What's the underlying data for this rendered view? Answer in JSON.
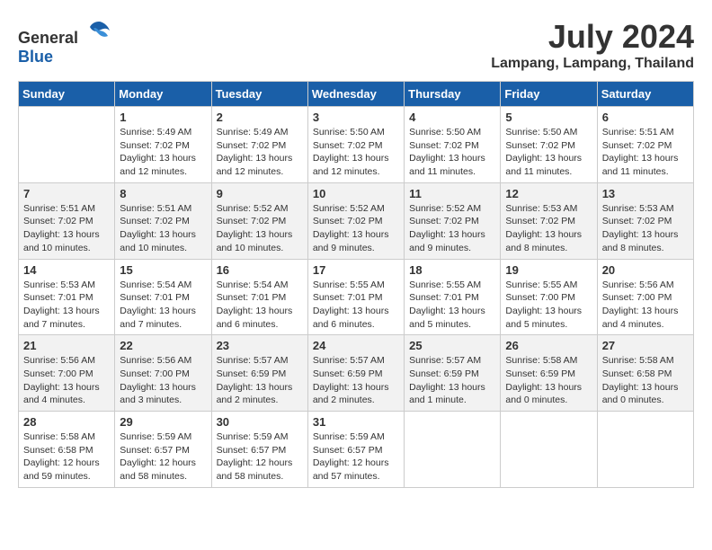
{
  "header": {
    "logo_general": "General",
    "logo_blue": "Blue",
    "month_title": "July 2024",
    "location": "Lampang, Lampang, Thailand"
  },
  "days_of_week": [
    "Sunday",
    "Monday",
    "Tuesday",
    "Wednesday",
    "Thursday",
    "Friday",
    "Saturday"
  ],
  "weeks": [
    [
      {
        "day": "",
        "sunrise": "",
        "sunset": "",
        "daylight": ""
      },
      {
        "day": "1",
        "sunrise": "Sunrise: 5:49 AM",
        "sunset": "Sunset: 7:02 PM",
        "daylight": "Daylight: 13 hours and 12 minutes."
      },
      {
        "day": "2",
        "sunrise": "Sunrise: 5:49 AM",
        "sunset": "Sunset: 7:02 PM",
        "daylight": "Daylight: 13 hours and 12 minutes."
      },
      {
        "day": "3",
        "sunrise": "Sunrise: 5:50 AM",
        "sunset": "Sunset: 7:02 PM",
        "daylight": "Daylight: 13 hours and 12 minutes."
      },
      {
        "day": "4",
        "sunrise": "Sunrise: 5:50 AM",
        "sunset": "Sunset: 7:02 PM",
        "daylight": "Daylight: 13 hours and 11 minutes."
      },
      {
        "day": "5",
        "sunrise": "Sunrise: 5:50 AM",
        "sunset": "Sunset: 7:02 PM",
        "daylight": "Daylight: 13 hours and 11 minutes."
      },
      {
        "day": "6",
        "sunrise": "Sunrise: 5:51 AM",
        "sunset": "Sunset: 7:02 PM",
        "daylight": "Daylight: 13 hours and 11 minutes."
      }
    ],
    [
      {
        "day": "7",
        "sunrise": "Sunrise: 5:51 AM",
        "sunset": "Sunset: 7:02 PM",
        "daylight": "Daylight: 13 hours and 10 minutes."
      },
      {
        "day": "8",
        "sunrise": "Sunrise: 5:51 AM",
        "sunset": "Sunset: 7:02 PM",
        "daylight": "Daylight: 13 hours and 10 minutes."
      },
      {
        "day": "9",
        "sunrise": "Sunrise: 5:52 AM",
        "sunset": "Sunset: 7:02 PM",
        "daylight": "Daylight: 13 hours and 10 minutes."
      },
      {
        "day": "10",
        "sunrise": "Sunrise: 5:52 AM",
        "sunset": "Sunset: 7:02 PM",
        "daylight": "Daylight: 13 hours and 9 minutes."
      },
      {
        "day": "11",
        "sunrise": "Sunrise: 5:52 AM",
        "sunset": "Sunset: 7:02 PM",
        "daylight": "Daylight: 13 hours and 9 minutes."
      },
      {
        "day": "12",
        "sunrise": "Sunrise: 5:53 AM",
        "sunset": "Sunset: 7:02 PM",
        "daylight": "Daylight: 13 hours and 8 minutes."
      },
      {
        "day": "13",
        "sunrise": "Sunrise: 5:53 AM",
        "sunset": "Sunset: 7:02 PM",
        "daylight": "Daylight: 13 hours and 8 minutes."
      }
    ],
    [
      {
        "day": "14",
        "sunrise": "Sunrise: 5:53 AM",
        "sunset": "Sunset: 7:01 PM",
        "daylight": "Daylight: 13 hours and 7 minutes."
      },
      {
        "day": "15",
        "sunrise": "Sunrise: 5:54 AM",
        "sunset": "Sunset: 7:01 PM",
        "daylight": "Daylight: 13 hours and 7 minutes."
      },
      {
        "day": "16",
        "sunrise": "Sunrise: 5:54 AM",
        "sunset": "Sunset: 7:01 PM",
        "daylight": "Daylight: 13 hours and 6 minutes."
      },
      {
        "day": "17",
        "sunrise": "Sunrise: 5:55 AM",
        "sunset": "Sunset: 7:01 PM",
        "daylight": "Daylight: 13 hours and 6 minutes."
      },
      {
        "day": "18",
        "sunrise": "Sunrise: 5:55 AM",
        "sunset": "Sunset: 7:01 PM",
        "daylight": "Daylight: 13 hours and 5 minutes."
      },
      {
        "day": "19",
        "sunrise": "Sunrise: 5:55 AM",
        "sunset": "Sunset: 7:00 PM",
        "daylight": "Daylight: 13 hours and 5 minutes."
      },
      {
        "day": "20",
        "sunrise": "Sunrise: 5:56 AM",
        "sunset": "Sunset: 7:00 PM",
        "daylight": "Daylight: 13 hours and 4 minutes."
      }
    ],
    [
      {
        "day": "21",
        "sunrise": "Sunrise: 5:56 AM",
        "sunset": "Sunset: 7:00 PM",
        "daylight": "Daylight: 13 hours and 4 minutes."
      },
      {
        "day": "22",
        "sunrise": "Sunrise: 5:56 AM",
        "sunset": "Sunset: 7:00 PM",
        "daylight": "Daylight: 13 hours and 3 minutes."
      },
      {
        "day": "23",
        "sunrise": "Sunrise: 5:57 AM",
        "sunset": "Sunset: 6:59 PM",
        "daylight": "Daylight: 13 hours and 2 minutes."
      },
      {
        "day": "24",
        "sunrise": "Sunrise: 5:57 AM",
        "sunset": "Sunset: 6:59 PM",
        "daylight": "Daylight: 13 hours and 2 minutes."
      },
      {
        "day": "25",
        "sunrise": "Sunrise: 5:57 AM",
        "sunset": "Sunset: 6:59 PM",
        "daylight": "Daylight: 13 hours and 1 minute."
      },
      {
        "day": "26",
        "sunrise": "Sunrise: 5:58 AM",
        "sunset": "Sunset: 6:59 PM",
        "daylight": "Daylight: 13 hours and 0 minutes."
      },
      {
        "day": "27",
        "sunrise": "Sunrise: 5:58 AM",
        "sunset": "Sunset: 6:58 PM",
        "daylight": "Daylight: 13 hours and 0 minutes."
      }
    ],
    [
      {
        "day": "28",
        "sunrise": "Sunrise: 5:58 AM",
        "sunset": "Sunset: 6:58 PM",
        "daylight": "Daylight: 12 hours and 59 minutes."
      },
      {
        "day": "29",
        "sunrise": "Sunrise: 5:59 AM",
        "sunset": "Sunset: 6:57 PM",
        "daylight": "Daylight: 12 hours and 58 minutes."
      },
      {
        "day": "30",
        "sunrise": "Sunrise: 5:59 AM",
        "sunset": "Sunset: 6:57 PM",
        "daylight": "Daylight: 12 hours and 58 minutes."
      },
      {
        "day": "31",
        "sunrise": "Sunrise: 5:59 AM",
        "sunset": "Sunset: 6:57 PM",
        "daylight": "Daylight: 12 hours and 57 minutes."
      },
      {
        "day": "",
        "sunrise": "",
        "sunset": "",
        "daylight": ""
      },
      {
        "day": "",
        "sunrise": "",
        "sunset": "",
        "daylight": ""
      },
      {
        "day": "",
        "sunrise": "",
        "sunset": "",
        "daylight": ""
      }
    ]
  ]
}
